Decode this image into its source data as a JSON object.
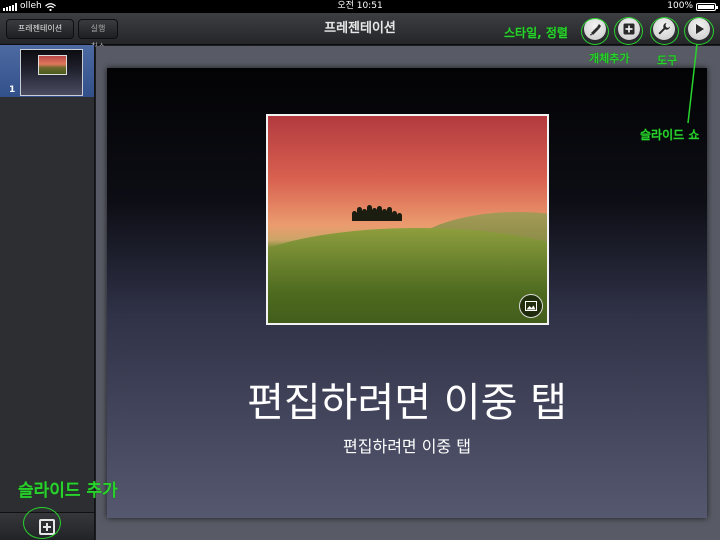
{
  "status_bar": {
    "carrier": "olleh",
    "time": "오전 10:51",
    "battery": "100%",
    "battery_level": 1.0
  },
  "toolbar": {
    "presentations_label": "프레젠테이션",
    "undo_label": "실행 취소",
    "title": "프레젠테이션",
    "icons": [
      "brush-icon",
      "insert-object-icon",
      "wrench-icon",
      "play-icon"
    ]
  },
  "sidebar": {
    "slides": [
      {
        "number": "1"
      }
    ]
  },
  "slide": {
    "title_placeholder": "편집하려면 이중 탭",
    "subtitle_placeholder": "편집하려면 이중 탭"
  },
  "annotations": {
    "style_label": "스타일, 정렬",
    "object_label": "개체추가",
    "tools_label": "도구",
    "slideshow_label": "슬라이드 쇼",
    "add_slide_label": "슬라이드 추가",
    "color": "#29d22d"
  }
}
